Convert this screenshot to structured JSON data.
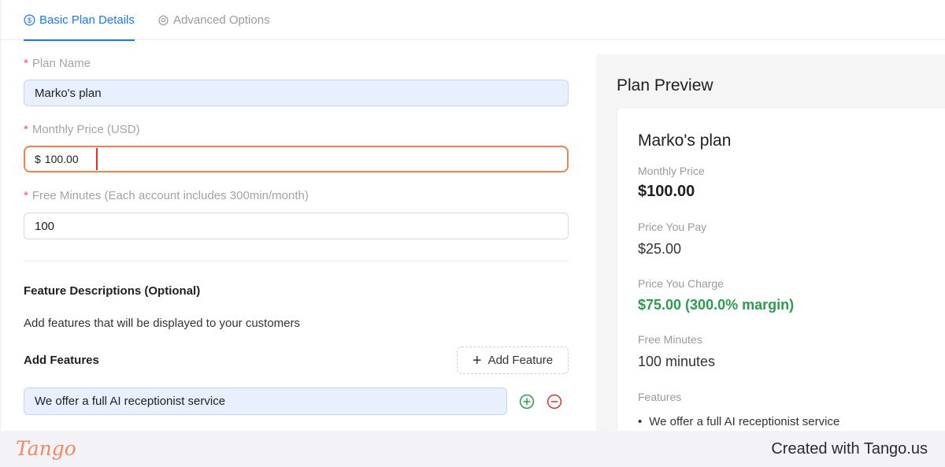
{
  "tabs": [
    {
      "label": "Basic Plan Details",
      "icon": "dollar-circle-icon",
      "active": true
    },
    {
      "label": "Advanced Options",
      "icon": "gear-icon",
      "active": false
    }
  ],
  "form": {
    "plan_name": {
      "label": "Plan Name",
      "required": "*",
      "value": "Marko's plan"
    },
    "monthly_price": {
      "label": "Monthly Price (USD)",
      "required": "*",
      "currency": "$",
      "value": "100.00"
    },
    "free_minutes": {
      "label": "Free Minutes (Each account includes 300min/month)",
      "required": "*",
      "value": "100"
    },
    "features_section": {
      "title": "Feature Descriptions (Optional)",
      "description": "Add features that will be displayed to your customers",
      "add_title": "Add Features",
      "add_button": "Add Feature",
      "items": [
        "We offer a full AI receptionist service"
      ]
    }
  },
  "preview": {
    "title": "Plan Preview",
    "plan_name": "Marko's plan",
    "monthly_price_label": "Monthly Price",
    "monthly_price": "$100.00",
    "price_you_pay_label": "Price You Pay",
    "price_you_pay": "$25.00",
    "price_you_charge_label": "Price You Charge",
    "price_you_charge": "$75.00 (300.0% margin)",
    "free_minutes_label": "Free Minutes",
    "free_minutes": "100 minutes",
    "features_label": "Features",
    "features": [
      "We offer a full AI receptionist service"
    ],
    "bullet": "•"
  },
  "footer": {
    "logo": "Tango",
    "created_with": "Created with Tango.us"
  },
  "colors": {
    "accent": "#1677ff",
    "required": "#ff4d4f",
    "highlight": "#f0824a",
    "margin_green": "#2a9d4a",
    "add_green": "#2a9d4a",
    "remove_red": "#e0322b"
  }
}
